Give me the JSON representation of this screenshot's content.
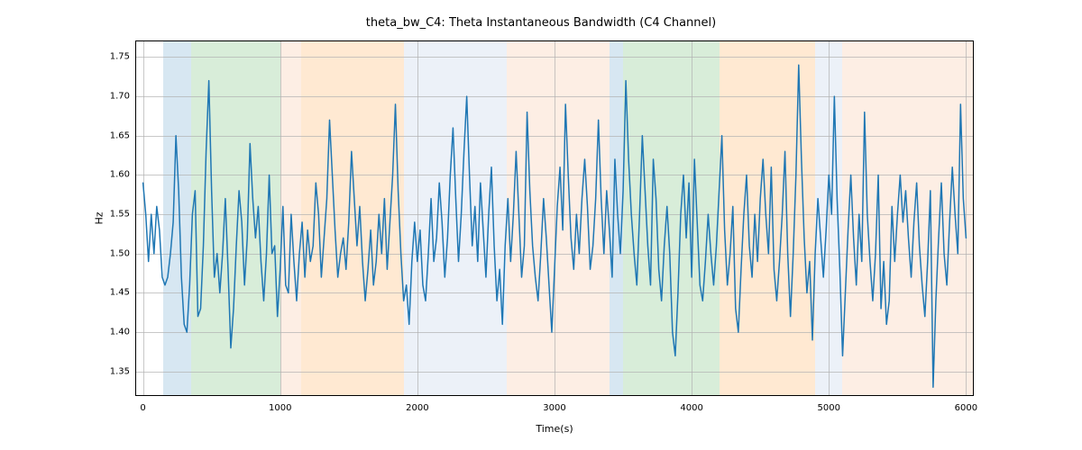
{
  "chart_data": {
    "type": "line",
    "title": "theta_bw_C4: Theta Instantaneous Bandwidth (C4 Channel)",
    "xlabel": "Time(s)",
    "ylabel": "Hz",
    "xlim": [
      -50,
      6050
    ],
    "ylim": [
      1.32,
      1.77
    ],
    "xticks": [
      0,
      1000,
      2000,
      3000,
      4000,
      5000,
      6000
    ],
    "yticks": [
      1.35,
      1.4,
      1.45,
      1.5,
      1.55,
      1.6,
      1.65,
      1.7,
      1.75
    ],
    "bands": [
      {
        "start": 150,
        "end": 350,
        "color": "#4a90c2"
      },
      {
        "start": 350,
        "end": 1000,
        "color": "#4caf50"
      },
      {
        "start": 1000,
        "end": 1150,
        "color": "#f5b183"
      },
      {
        "start": 1150,
        "end": 1900,
        "color": "#ff9933"
      },
      {
        "start": 1900,
        "end": 2650,
        "color": "#a8c0de"
      },
      {
        "start": 2650,
        "end": 3400,
        "color": "#f5b183"
      },
      {
        "start": 3400,
        "end": 3500,
        "color": "#4a90c2"
      },
      {
        "start": 3500,
        "end": 4200,
        "color": "#4caf50"
      },
      {
        "start": 4200,
        "end": 4900,
        "color": "#ff9933"
      },
      {
        "start": 4900,
        "end": 5100,
        "color": "#a8c0de"
      },
      {
        "start": 5100,
        "end": 6050,
        "color": "#f5b183"
      }
    ],
    "x": [
      0,
      20,
      40,
      60,
      80,
      100,
      120,
      140,
      160,
      180,
      200,
      220,
      240,
      260,
      280,
      300,
      320,
      340,
      360,
      380,
      400,
      420,
      440,
      460,
      480,
      500,
      520,
      540,
      560,
      580,
      600,
      620,
      640,
      660,
      680,
      700,
      720,
      740,
      760,
      780,
      800,
      820,
      840,
      860,
      880,
      900,
      920,
      940,
      960,
      980,
      1000,
      1020,
      1040,
      1060,
      1080,
      1100,
      1120,
      1140,
      1160,
      1180,
      1200,
      1220,
      1240,
      1260,
      1280,
      1300,
      1320,
      1340,
      1360,
      1380,
      1400,
      1420,
      1440,
      1460,
      1480,
      1500,
      1520,
      1540,
      1560,
      1580,
      1600,
      1620,
      1640,
      1660,
      1680,
      1700,
      1720,
      1740,
      1760,
      1780,
      1800,
      1820,
      1840,
      1860,
      1880,
      1900,
      1920,
      1940,
      1960,
      1980,
      2000,
      2020,
      2040,
      2060,
      2080,
      2100,
      2120,
      2140,
      2160,
      2180,
      2200,
      2220,
      2240,
      2260,
      2280,
      2300,
      2320,
      2340,
      2360,
      2380,
      2400,
      2420,
      2440,
      2460,
      2480,
      2500,
      2520,
      2540,
      2560,
      2580,
      2600,
      2620,
      2640,
      2660,
      2680,
      2700,
      2720,
      2740,
      2760,
      2780,
      2800,
      2820,
      2840,
      2860,
      2880,
      2900,
      2920,
      2940,
      2960,
      2980,
      3000,
      3020,
      3040,
      3060,
      3080,
      3100,
      3120,
      3140,
      3160,
      3180,
      3200,
      3220,
      3240,
      3260,
      3280,
      3300,
      3320,
      3340,
      3360,
      3380,
      3400,
      3420,
      3440,
      3460,
      3480,
      3500,
      3520,
      3540,
      3560,
      3580,
      3600,
      3620,
      3640,
      3660,
      3680,
      3700,
      3720,
      3740,
      3760,
      3780,
      3800,
      3820,
      3840,
      3860,
      3880,
      3900,
      3920,
      3940,
      3960,
      3980,
      4000,
      4020,
      4040,
      4060,
      4080,
      4100,
      4120,
      4140,
      4160,
      4180,
      4200,
      4220,
      4240,
      4260,
      4280,
      4300,
      4320,
      4340,
      4360,
      4380,
      4400,
      4420,
      4440,
      4460,
      4480,
      4500,
      4520,
      4540,
      4560,
      4580,
      4600,
      4620,
      4640,
      4660,
      4680,
      4700,
      4720,
      4740,
      4760,
      4780,
      4800,
      4820,
      4840,
      4860,
      4880,
      4900,
      4920,
      4940,
      4960,
      4980,
      5000,
      5020,
      5040,
      5060,
      5080,
      5100,
      5120,
      5140,
      5160,
      5180,
      5200,
      5220,
      5240,
      5260,
      5280,
      5300,
      5320,
      5340,
      5360,
      5380,
      5400,
      5420,
      5440,
      5460,
      5480,
      5500,
      5520,
      5540,
      5560,
      5580,
      5600,
      5620,
      5640,
      5660,
      5680,
      5700,
      5720,
      5740,
      5760,
      5780,
      5800,
      5820,
      5840,
      5860,
      5880,
      5900,
      5920,
      5940,
      5960,
      5980,
      6000
    ],
    "values": [
      1.59,
      1.55,
      1.49,
      1.55,
      1.5,
      1.56,
      1.53,
      1.47,
      1.46,
      1.47,
      1.5,
      1.54,
      1.65,
      1.58,
      1.47,
      1.41,
      1.4,
      1.46,
      1.55,
      1.58,
      1.42,
      1.43,
      1.51,
      1.63,
      1.72,
      1.58,
      1.47,
      1.5,
      1.45,
      1.5,
      1.57,
      1.48,
      1.38,
      1.43,
      1.51,
      1.58,
      1.54,
      1.46,
      1.52,
      1.64,
      1.57,
      1.52,
      1.56,
      1.49,
      1.44,
      1.5,
      1.6,
      1.5,
      1.51,
      1.42,
      1.48,
      1.56,
      1.46,
      1.45,
      1.55,
      1.49,
      1.44,
      1.5,
      1.54,
      1.47,
      1.53,
      1.49,
      1.51,
      1.59,
      1.55,
      1.47,
      1.52,
      1.57,
      1.67,
      1.6,
      1.53,
      1.47,
      1.5,
      1.52,
      1.48,
      1.54,
      1.63,
      1.57,
      1.51,
      1.56,
      1.49,
      1.44,
      1.48,
      1.53,
      1.46,
      1.49,
      1.55,
      1.5,
      1.57,
      1.48,
      1.54,
      1.6,
      1.69,
      1.58,
      1.5,
      1.44,
      1.46,
      1.41,
      1.49,
      1.54,
      1.49,
      1.53,
      1.46,
      1.44,
      1.5,
      1.57,
      1.49,
      1.52,
      1.59,
      1.54,
      1.47,
      1.52,
      1.6,
      1.66,
      1.57,
      1.49,
      1.55,
      1.63,
      1.7,
      1.6,
      1.51,
      1.56,
      1.49,
      1.59,
      1.53,
      1.47,
      1.55,
      1.61,
      1.51,
      1.44,
      1.48,
      1.41,
      1.51,
      1.57,
      1.49,
      1.55,
      1.63,
      1.55,
      1.47,
      1.51,
      1.68,
      1.58,
      1.51,
      1.47,
      1.44,
      1.5,
      1.57,
      1.52,
      1.46,
      1.4,
      1.48,
      1.56,
      1.61,
      1.53,
      1.69,
      1.6,
      1.52,
      1.48,
      1.55,
      1.5,
      1.57,
      1.62,
      1.56,
      1.48,
      1.51,
      1.57,
      1.67,
      1.57,
      1.5,
      1.58,
      1.53,
      1.47,
      1.62,
      1.55,
      1.5,
      1.58,
      1.72,
      1.62,
      1.55,
      1.5,
      1.46,
      1.55,
      1.65,
      1.58,
      1.51,
      1.46,
      1.62,
      1.57,
      1.48,
      1.44,
      1.51,
      1.56,
      1.5,
      1.4,
      1.37,
      1.45,
      1.55,
      1.6,
      1.52,
      1.59,
      1.47,
      1.62,
      1.54,
      1.46,
      1.44,
      1.49,
      1.55,
      1.5,
      1.46,
      1.51,
      1.58,
      1.65,
      1.53,
      1.46,
      1.5,
      1.56,
      1.43,
      1.4,
      1.48,
      1.55,
      1.6,
      1.51,
      1.47,
      1.55,
      1.49,
      1.57,
      1.62,
      1.55,
      1.5,
      1.61,
      1.48,
      1.44,
      1.49,
      1.55,
      1.63,
      1.5,
      1.42,
      1.5,
      1.6,
      1.74,
      1.62,
      1.52,
      1.45,
      1.49,
      1.39,
      1.5,
      1.57,
      1.52,
      1.47,
      1.53,
      1.6,
      1.55,
      1.7,
      1.57,
      1.48,
      1.37,
      1.45,
      1.53,
      1.6,
      1.52,
      1.46,
      1.55,
      1.49,
      1.68,
      1.55,
      1.49,
      1.44,
      1.5,
      1.6,
      1.43,
      1.49,
      1.41,
      1.44,
      1.56,
      1.49,
      1.55,
      1.6,
      1.54,
      1.58,
      1.52,
      1.47,
      1.54,
      1.59,
      1.51,
      1.46,
      1.42,
      1.49,
      1.58,
      1.33,
      1.44,
      1.52,
      1.59,
      1.5,
      1.46,
      1.54,
      1.61,
      1.55,
      1.5,
      1.69,
      1.57,
      1.52
    ]
  }
}
